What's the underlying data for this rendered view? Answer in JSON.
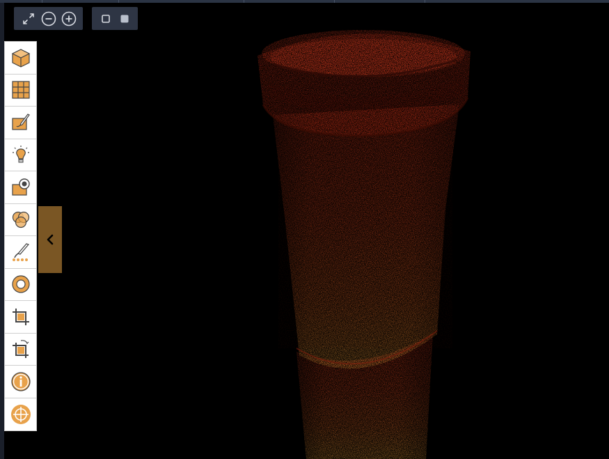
{
  "colors": {
    "background": "#000000",
    "toolbar_bg": "#2e3544",
    "icon_accent": "#e8a24b",
    "icon_stroke": "#444444",
    "collapse_tab": "#7a5624",
    "cloud_top": "#d4361c",
    "cloud_bottom": "#f0a23a"
  },
  "view_toolbar": {
    "icons": [
      "fit-view-icon",
      "zoom-out-icon",
      "zoom-in-icon"
    ]
  },
  "shape_toolbar": {
    "icons": [
      "square-outline-icon",
      "square-filled-icon"
    ]
  },
  "side_toolbar": {
    "items": [
      {
        "name": "cube-icon"
      },
      {
        "name": "grid-icon"
      },
      {
        "name": "paint-brush-canvas-icon"
      },
      {
        "name": "lightbulb-icon"
      },
      {
        "name": "camera-view-icon"
      },
      {
        "name": "color-channels-icon"
      },
      {
        "name": "brush-points-icon"
      },
      {
        "name": "ring-icon"
      },
      {
        "name": "crop-icon"
      },
      {
        "name": "crop-rotate-icon"
      },
      {
        "name": "info-icon"
      },
      {
        "name": "crosshair-icon"
      }
    ]
  },
  "collapse_tab": {
    "icon": "chevron-left-icon"
  }
}
